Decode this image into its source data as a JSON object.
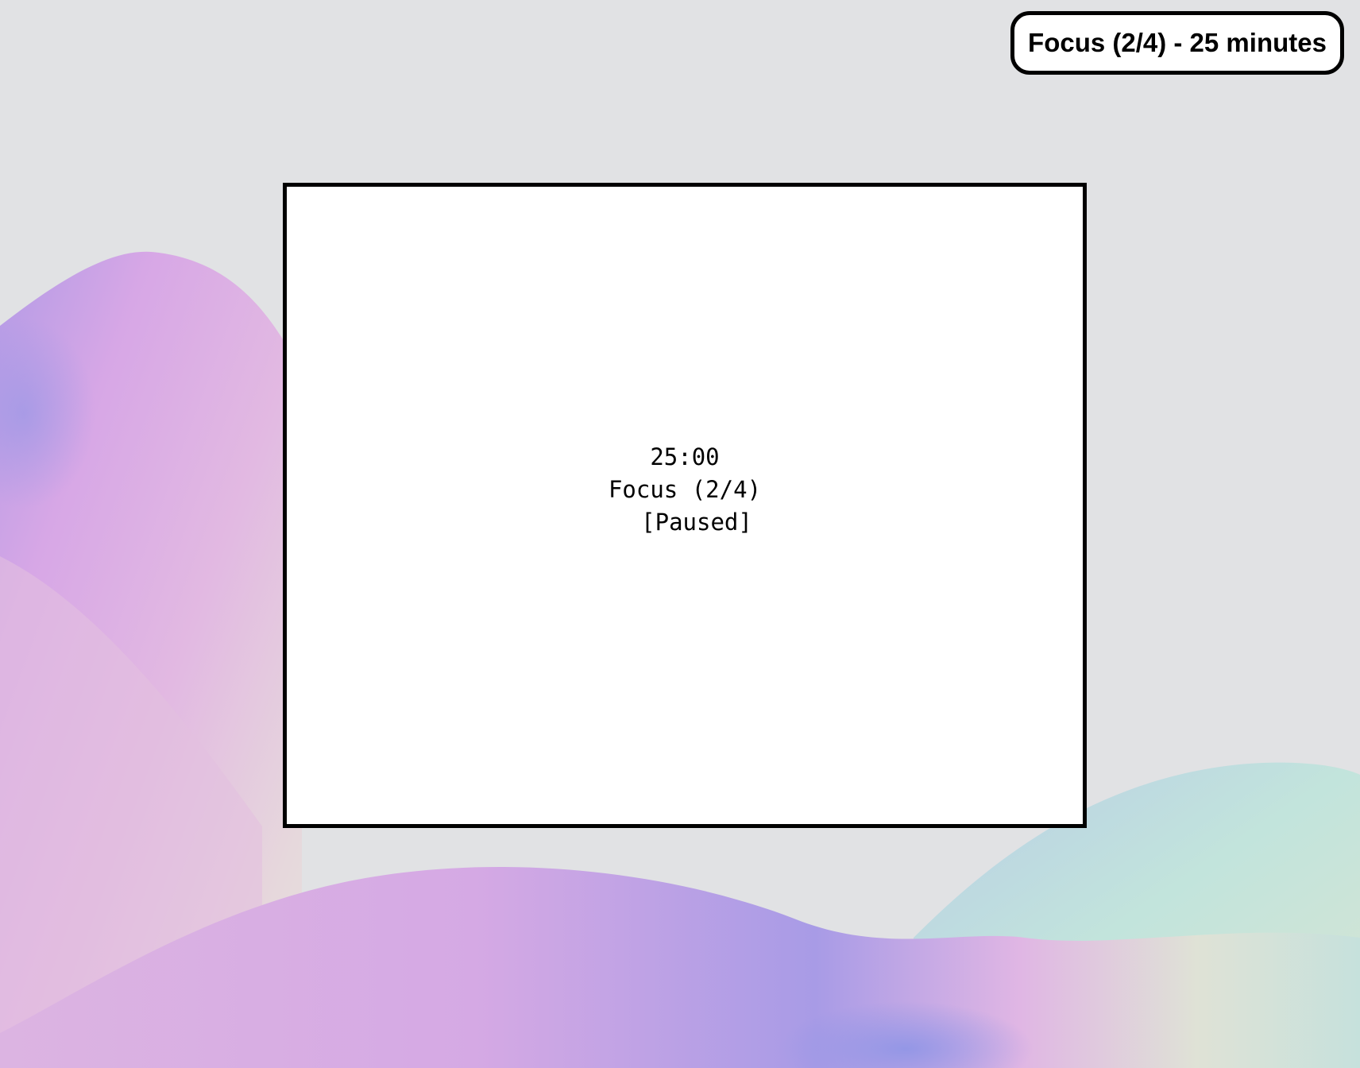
{
  "notification": {
    "text": "Focus (2/4) - 25 minutes"
  },
  "timer": {
    "time": "25:00",
    "session": "Focus (2/4)",
    "status": "[Paused]"
  },
  "colors": {
    "background": "#e1e2e4",
    "wallpaper_pink": "#dcaee0",
    "wallpaper_violet": "#a98fe0",
    "wallpaper_teal": "#bfe3d9",
    "border": "#000000"
  }
}
